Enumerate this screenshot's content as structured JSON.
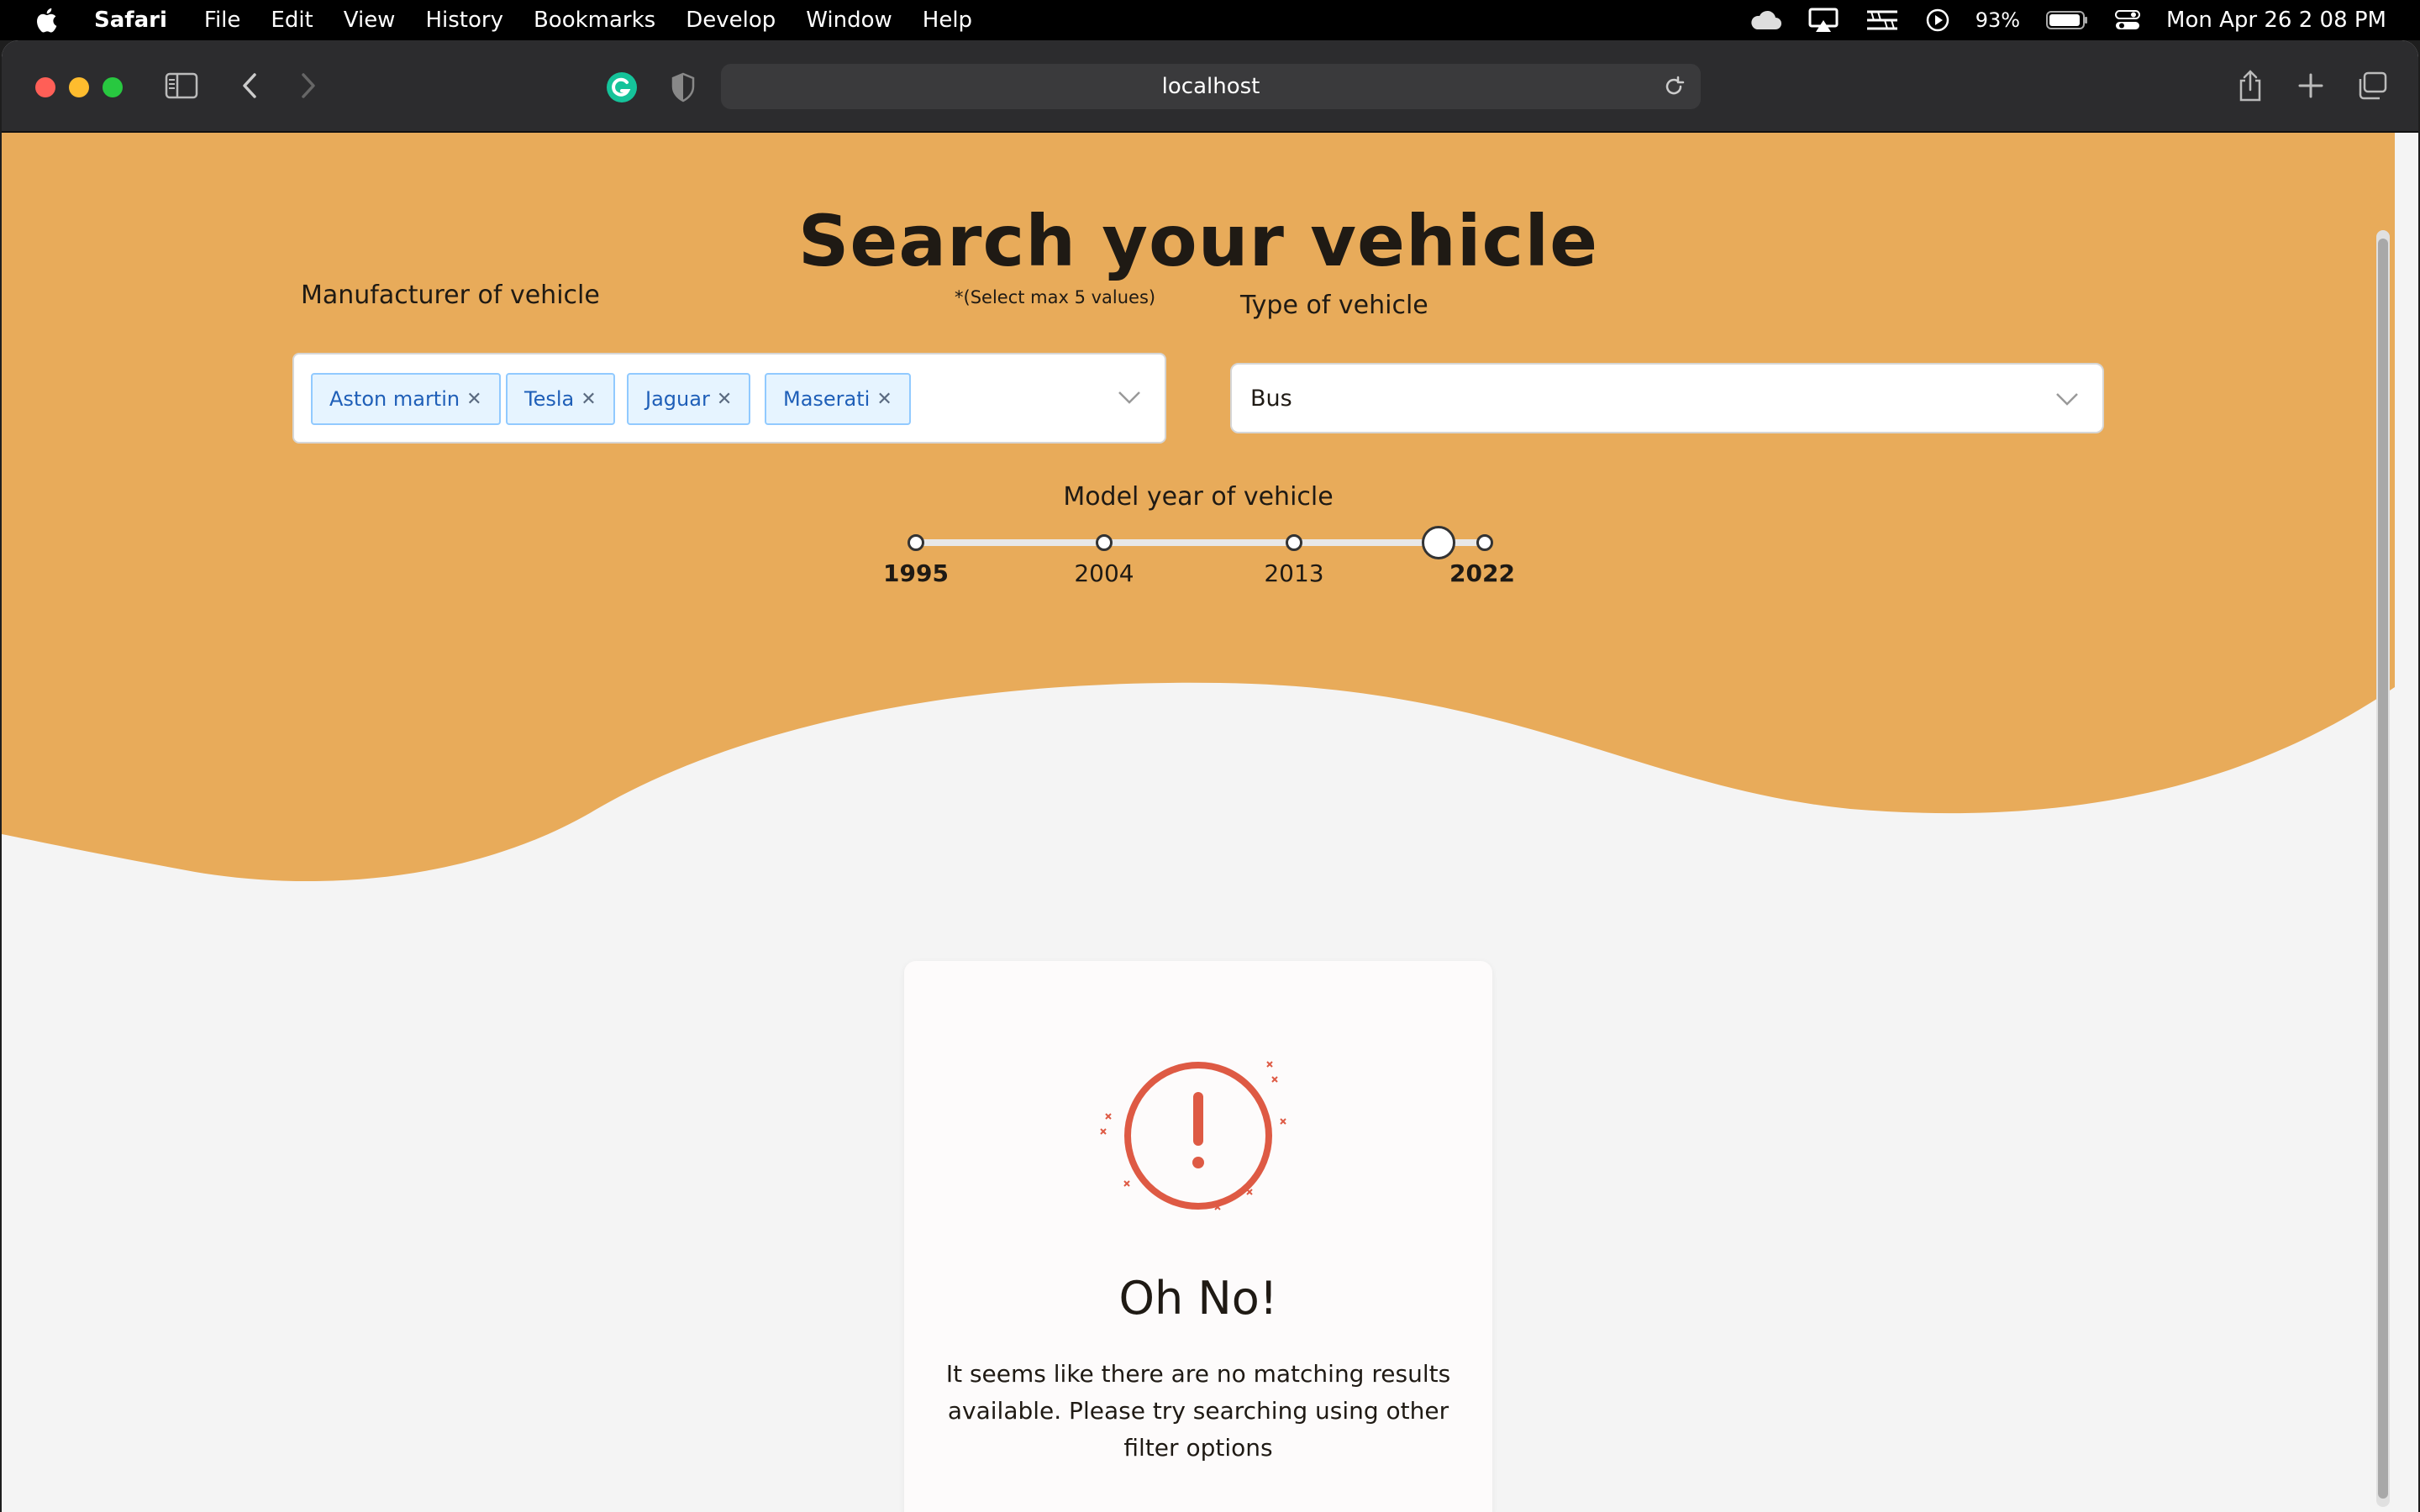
{
  "menubar": {
    "app": "Safari",
    "items": [
      "File",
      "Edit",
      "View",
      "History",
      "Bookmarks",
      "Develop",
      "Window",
      "Help"
    ],
    "battery": "93%",
    "datetime": "Mon Apr 26  2 08 PM"
  },
  "browser": {
    "url": "localhost"
  },
  "hero": {
    "title": "Search your vehicle",
    "background_color": "#e8ab5a"
  },
  "manufacturer": {
    "label": "Manufacturer of vehicle",
    "hint": "*(Select max 5 values)",
    "selected": [
      "Aston martin",
      "Tesla",
      "Jaguar",
      "Maserati"
    ]
  },
  "vehicle_type": {
    "label": "Type of vehicle",
    "value": "Bus"
  },
  "model_year": {
    "label": "Model year of vehicle",
    "marks": [
      "1995",
      "2004",
      "2013",
      "2022"
    ],
    "min": 1995,
    "max": 2022,
    "selected_value_fraction": 0.92
  },
  "empty_state": {
    "title": "Oh No!",
    "message": "It seems like there are no matching results available. Please try searching using other filter options",
    "icon": "alert-circle-icon",
    "icon_color": "#de5a44"
  }
}
